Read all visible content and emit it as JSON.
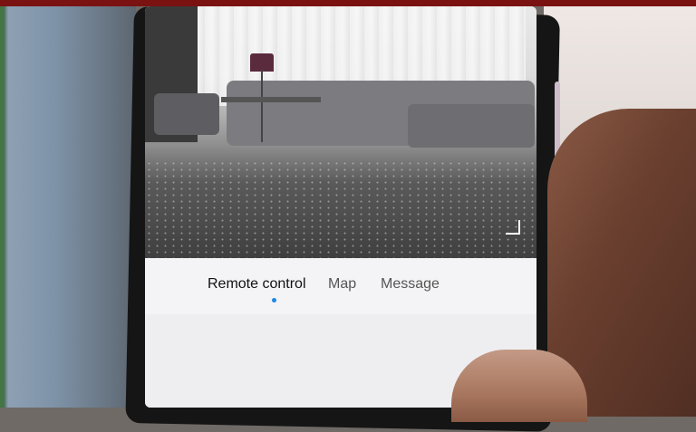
{
  "tabs": {
    "remote_control": "Remote control",
    "map": "Map",
    "message": "Message",
    "active": "remote_control"
  },
  "colors": {
    "accent": "#1e88e5",
    "top_bar": "#7a1212"
  }
}
